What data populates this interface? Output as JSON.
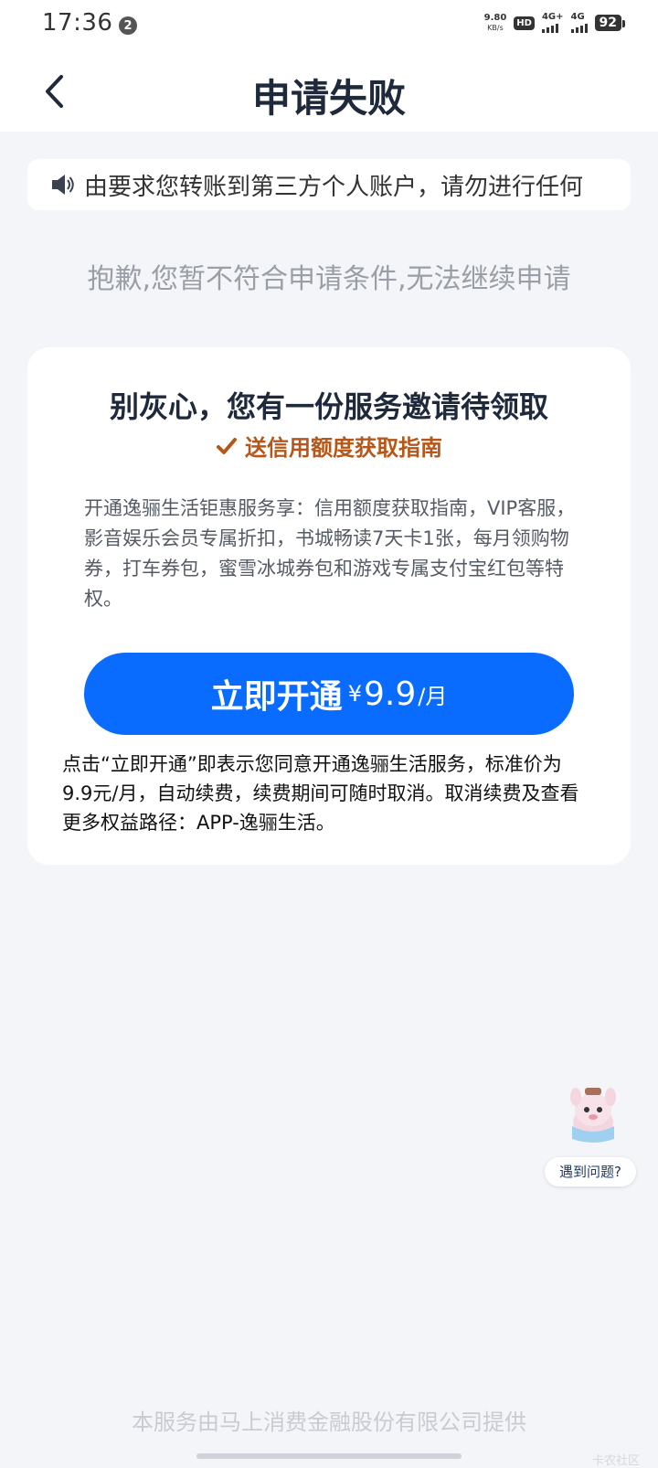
{
  "status_bar": {
    "time": "17:36",
    "notification_count": "2",
    "net_speed_value": "9.80",
    "net_speed_unit": "KB/s",
    "hd_label": "HD",
    "signal1_label": "4G+",
    "signal2_label": "4G",
    "battery": "92"
  },
  "nav": {
    "title": "申请失败"
  },
  "notice": {
    "text": "由要求您转账到第三方个人账户，请勿进行任何"
  },
  "sorry_text": "抱歉,您暂不符合申请条件,无法继续申请",
  "card": {
    "title": "别灰心，您有一份服务邀请待领取",
    "subtitle": "送信用额度获取指南",
    "description": "开通逸骊生活钜惠服务享：信用额度获取指南，VIP客服，影音娱乐会员专属折扣，书城畅读7天卡1张，每月领购物券，打车券包，蜜雪冰城券包和游戏专属支付宝红包等特权。",
    "cta": {
      "label": "立即开通",
      "currency": "¥",
      "price": "9.9",
      "unit": "/月"
    },
    "agreement": "点击“立即开通”即表示您同意开通逸骊生活服务，标准价为9.9元/月，自动续费，续费期间可随时取消。取消续费及查看更多权益路径：APP-逸骊生活。"
  },
  "help": {
    "label": "遇到问题?"
  },
  "footer": {
    "text": "本服务由马上消费金融股份有限公司提供",
    "watermark": "卡农社区"
  },
  "colors": {
    "primary": "#0a6cff",
    "accent_orange": "#b5571a",
    "background": "#f4f5f9"
  }
}
